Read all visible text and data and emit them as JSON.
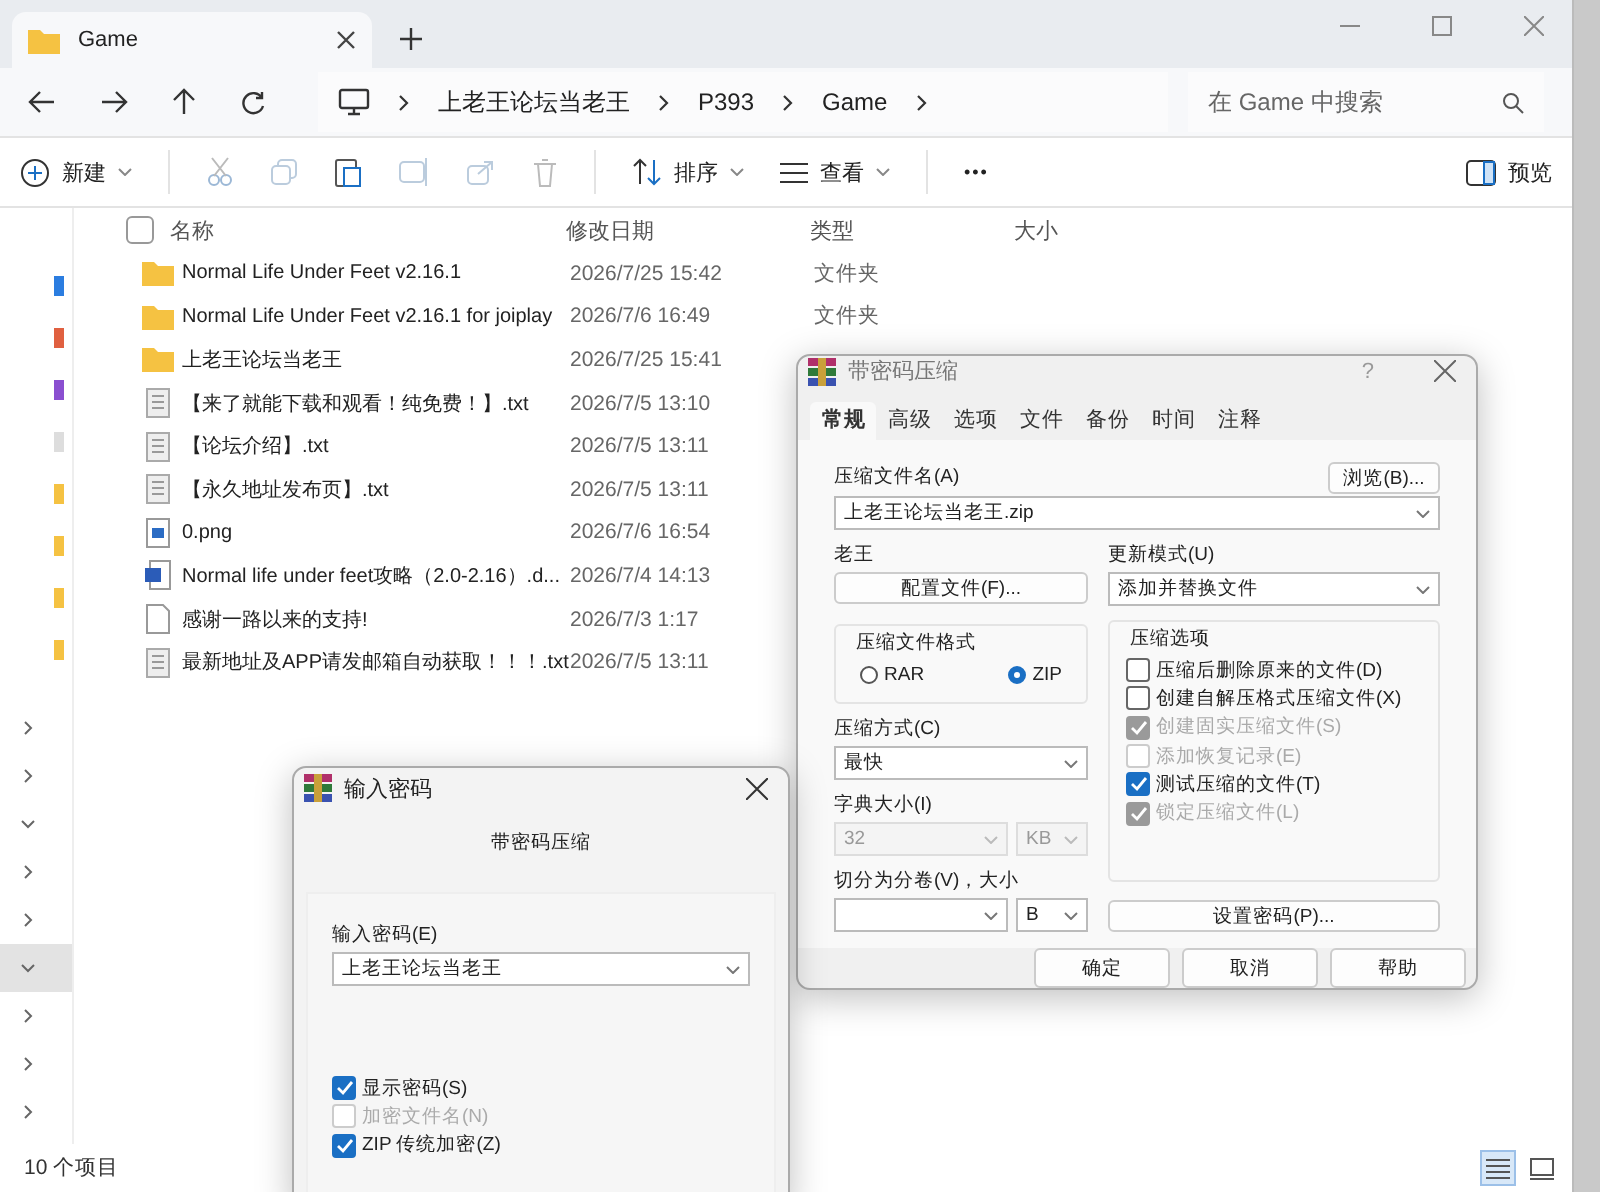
{
  "explorer": {
    "tab_title": "Game",
    "path": [
      "上老王论坛当老王",
      "P393",
      "Game"
    ],
    "search": {
      "placeholder": "在 Game 中搜索"
    }
  },
  "toolbar": {
    "new": "新建",
    "sort": "排序",
    "view": "查看",
    "more": "•••",
    "preview": "预览"
  },
  "columns": [
    "名称",
    "修改日期",
    "类型",
    "大小"
  ],
  "select_all": {
    "checked": false
  },
  "rows": [
    {
      "kind": "folder",
      "name": "Normal Life Under Feet v2.16.1",
      "date": "2026/7/25 15:42",
      "type": "文件夹"
    },
    {
      "kind": "folder",
      "name": "Normal Life Under Feet v2.16.1 for joiplay",
      "date": "2026/7/6 16:49",
      "type": "文件夹"
    },
    {
      "kind": "folder",
      "name": "上老王论坛当老王",
      "date": "2026/7/25 15:41"
    },
    {
      "kind": "text",
      "name": "【来了就能下载和观看！纯免费！】.txt",
      "date": "2026/7/5 13:10"
    },
    {
      "kind": "text",
      "name": "【论坛介绍】.txt",
      "date": "2026/7/5 13:11"
    },
    {
      "kind": "text",
      "name": "【永久地址发布页】.txt",
      "date": "2026/7/5 13:11"
    },
    {
      "kind": "image",
      "name": "0.png",
      "date": "2026/7/6 16:54"
    },
    {
      "kind": "word",
      "name": "Normal life under feet攻略（2.0-2.16）.d...",
      "date": "2026/7/4 14:13"
    },
    {
      "kind": "blank",
      "name": "感谢一路以来的支持!",
      "date": "2026/7/3 1:17"
    },
    {
      "kind": "text",
      "name": "最新地址及APP请发邮箱自动获取！！！.txt",
      "date": "2026/7/5 13:11"
    }
  ],
  "nav": [
    {
      "expanded": false,
      "selected": false
    },
    {
      "expanded": false,
      "selected": false
    },
    {
      "expanded": true,
      "selected": false
    },
    {
      "expanded": false,
      "selected": false
    },
    {
      "expanded": false,
      "selected": false
    },
    {
      "expanded": true,
      "selected": true
    },
    {
      "expanded": false,
      "selected": false
    },
    {
      "expanded": false,
      "selected": false
    },
    {
      "expanded": false,
      "selected": false
    }
  ],
  "status_bar": {
    "count": "10 个项目",
    "views": [
      {
        "kind": "details",
        "selected": true
      },
      {
        "kind": "tiles",
        "selected": false
      }
    ]
  },
  "archive_dialog": {
    "title": "带密码压缩",
    "help": "?",
    "tabs": [
      {
        "label": "常规",
        "selected": true
      },
      {
        "label": "高级",
        "selected": false
      },
      {
        "label": "选项",
        "selected": false
      },
      {
        "label": "文件",
        "selected": false
      },
      {
        "label": "备份",
        "selected": false
      },
      {
        "label": "时间",
        "selected": false
      },
      {
        "label": "注释",
        "selected": false
      }
    ],
    "name_label": "压缩文件名(A)",
    "browse": "浏览(B)...",
    "name_value": "上老王论坛当老王.zip",
    "profile_label": "老王",
    "profile_button": "配置文件(F)...",
    "update_label": "更新模式(U)",
    "update_value": "添加并替换文件",
    "format_title": "压缩文件格式",
    "formats": [
      {
        "label": "RAR",
        "selected": false
      },
      {
        "label": "ZIP",
        "selected": true
      }
    ],
    "method_label": "压缩方式(C)",
    "method_value": "最快",
    "dict_label": "字典大小(I)",
    "dict_value": "32",
    "dict_unit": "KB",
    "split_label": "切分为分卷(V)，大小",
    "split_unit": "B",
    "options_title": "压缩选项",
    "options": [
      {
        "label": "压缩后删除原来的文件(D)",
        "checked": false,
        "disabled": false
      },
      {
        "label": "创建自解压格式压缩文件(X)",
        "checked": false,
        "disabled": false
      },
      {
        "label": "创建固实压缩文件(S)",
        "checked": true,
        "disabled": true
      },
      {
        "label": "添加恢复记录(E)",
        "checked": false,
        "disabled": true
      },
      {
        "label": "测试压缩的文件(T)",
        "checked": true,
        "disabled": false
      },
      {
        "label": "锁定压缩文件(L)",
        "checked": true,
        "disabled": true
      }
    ],
    "set_password": "设置密码(P)...",
    "buttons": [
      "确定",
      "取消",
      "帮助"
    ]
  },
  "password_dialog": {
    "title": "输入密码",
    "subtitle": "带密码压缩",
    "field_label": "输入密码(E)",
    "field_value": "上老王论坛当老王",
    "options": [
      {
        "label": "显示密码(S)",
        "checked": true,
        "disabled": false
      },
      {
        "label": "加密文件名(N)",
        "checked": false,
        "disabled": true
      },
      {
        "label": "ZIP 传统加密(Z)",
        "checked": true,
        "disabled": false
      }
    ]
  }
}
